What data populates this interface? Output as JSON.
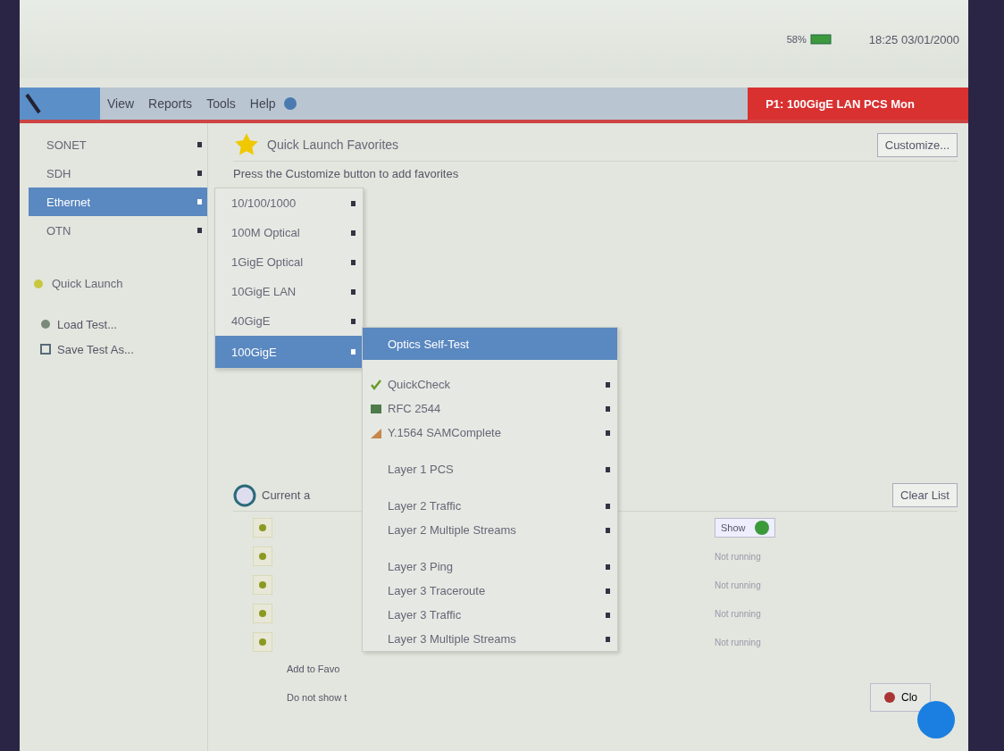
{
  "status_bar": {
    "battery": "58%",
    "datetime": "18:25 03/01/2000"
  },
  "menu_bar": {
    "items": [
      "View",
      "Reports",
      "Tools",
      "Help"
    ],
    "port_status": "P1: 100GigE LAN PCS Mon"
  },
  "sidebar": {
    "categories": [
      {
        "label": "SONET",
        "selected": false
      },
      {
        "label": "SDH",
        "selected": false
      },
      {
        "label": "Ethernet",
        "selected": true
      },
      {
        "label": "OTN",
        "selected": false
      }
    ],
    "quick_launch": "Quick Launch",
    "actions": [
      {
        "label": "Load Test...",
        "kind": "load"
      },
      {
        "label": "Save Test As...",
        "kind": "save"
      }
    ]
  },
  "favorites": {
    "title": "Quick Launch Favorites",
    "customize_button": "Customize...",
    "hint": "Press the Customize button to add favorites"
  },
  "recent": {
    "title": "Current a",
    "clear_button": "Clear List",
    "rows": [
      {
        "kind": "show",
        "label": "Show"
      },
      {
        "kind": "status",
        "label": "Not running"
      },
      {
        "kind": "status",
        "label": "Not running"
      },
      {
        "kind": "status",
        "label": "Not running"
      },
      {
        "kind": "status",
        "label": "Not running"
      }
    ],
    "add_to_favorites": "Add to Favo",
    "do_not_show": "Do not show t",
    "close_button": "Clo"
  },
  "submenu": {
    "items": [
      {
        "label": "10/100/1000",
        "selected": false
      },
      {
        "label": "100M Optical",
        "selected": false
      },
      {
        "label": "1GigE Optical",
        "selected": false
      },
      {
        "label": "10GigE LAN",
        "selected": false
      },
      {
        "label": "40GigE",
        "selected": false
      },
      {
        "label": "100GigE",
        "selected": true
      }
    ]
  },
  "test_menu": {
    "groups": [
      [
        {
          "label": "Optics Self-Test",
          "selected": true,
          "has_submenu": false
        }
      ],
      [
        {
          "label": "QuickCheck",
          "selected": false,
          "has_submenu": true,
          "kind": "check"
        },
        {
          "label": "RFC 2544",
          "selected": false,
          "has_submenu": true,
          "kind": "table"
        },
        {
          "label": "Y.1564 SAMComplete",
          "selected": false,
          "has_submenu": true,
          "kind": "chart"
        }
      ],
      [
        {
          "label": "Layer 1 PCS",
          "selected": false,
          "has_submenu": true
        }
      ],
      [
        {
          "label": "Layer 2 Traffic",
          "selected": false,
          "has_submenu": true
        },
        {
          "label": "Layer 2 Multiple Streams",
          "selected": false,
          "has_submenu": true
        }
      ],
      [
        {
          "label": "Layer 3 Ping",
          "selected": false,
          "has_submenu": true
        },
        {
          "label": "Layer 3 Traceroute",
          "selected": false,
          "has_submenu": true
        },
        {
          "label": "Layer 3 Traffic",
          "selected": false,
          "has_submenu": true
        },
        {
          "label": "Layer 3 Multiple Streams",
          "selected": false,
          "has_submenu": true
        }
      ]
    ]
  }
}
